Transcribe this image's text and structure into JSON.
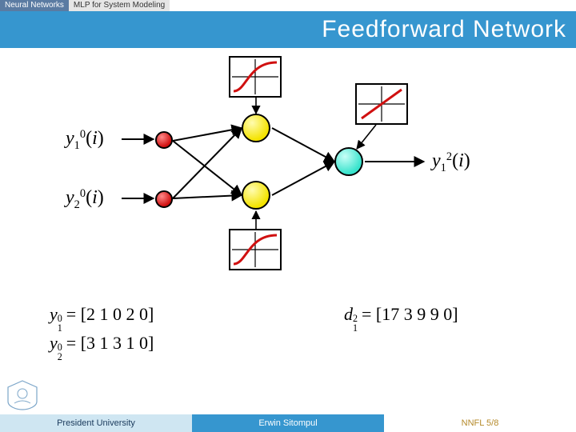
{
  "topbar": {
    "segA": "Neural Networks",
    "segB": "MLP for System Modeling"
  },
  "title": "Feedforward  Network",
  "footer": {
    "left": "President University",
    "center": "Erwin Sitompul",
    "right": "NNFL 5/8"
  },
  "labels": {
    "y10": "y₁⁰(i)",
    "y20": "y₂⁰(i)",
    "y12": "y₁²(i)"
  },
  "equations": {
    "y10vec": {
      "var": "y",
      "sub": "1",
      "sup": "0",
      "vals": "[2  1  0  2  0]"
    },
    "y20vec": {
      "var": "y",
      "sub": "2",
      "sup": "0",
      "vals": "[3  1  3  1  0]"
    },
    "d12vec": {
      "var": "d",
      "sub": "1",
      "sup": "2",
      "vals": "[17  3  9  9  0]"
    }
  },
  "activation": {
    "top": "sigmoid",
    "bottom": "sigmoid",
    "linear": "linear"
  }
}
